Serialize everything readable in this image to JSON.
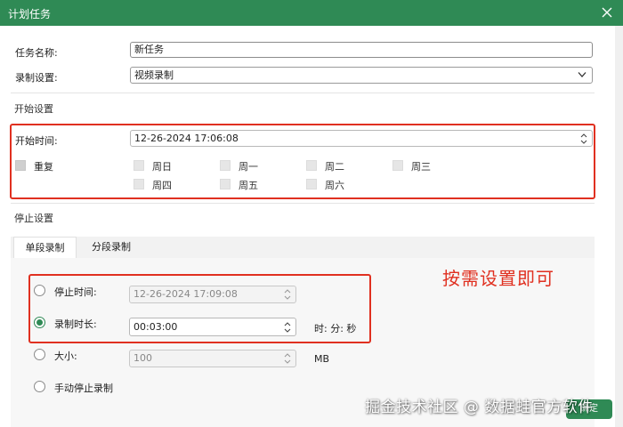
{
  "window": {
    "title": "计划任务"
  },
  "task_name": {
    "label": "任务名称:",
    "value": "新任务"
  },
  "record_setting": {
    "label": "录制设置:",
    "selected": "视频录制"
  },
  "start_section": {
    "title": "开始设置",
    "start_time_label": "开始时间:",
    "start_time_value": "12-26-2024 17:06:08",
    "repeat_label": "重复",
    "days": [
      "周日",
      "周一",
      "周二",
      "周三",
      "周四",
      "周五",
      "周六"
    ]
  },
  "stop_section": {
    "title": "停止设置",
    "tabs": [
      "单段录制",
      "分段录制"
    ],
    "active_tab": "单段录制",
    "stop_time_label": "停止时间:",
    "stop_time_value": "12-26-2024 17:09:08",
    "duration_label": "录制时长:",
    "duration_value": "00:03:00",
    "duration_unit": "时: 分: 秒",
    "size_label": "大小:",
    "size_value": "100",
    "size_unit": "MB",
    "manual_stop_label": "手动停止录制",
    "selected_option": "录制时长"
  },
  "annotation": "按需设置即可",
  "watermark": "掘金技术社区 @ 数据蛙官方软件",
  "confirm_button": "确定",
  "colors": {
    "accent": "#2f8a55",
    "highlight_box": "#e03020"
  }
}
